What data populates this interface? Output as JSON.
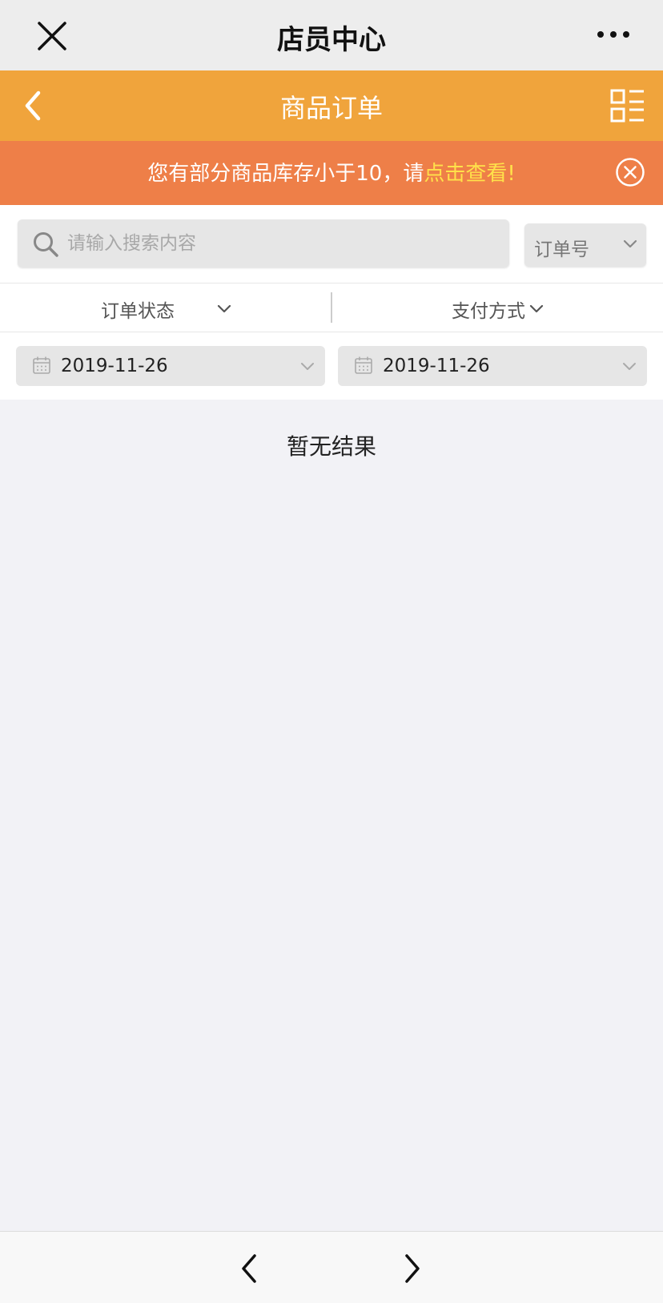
{
  "topbar": {
    "title": "店员中心",
    "close_icon": "close-icon",
    "more_icon": "more-icon"
  },
  "header": {
    "title": "商品订单",
    "back_icon": "chevron-left-icon",
    "menu_icon": "grid-list-icon",
    "color": "#f0a43c"
  },
  "alert": {
    "message": "您有部分商品库存小于10，请",
    "link": "点击查看!",
    "color": "#ee7f48",
    "link_color": "#ffe14a"
  },
  "search": {
    "placeholder": "请输入搜索内容",
    "value": "",
    "type_label": "订单号"
  },
  "filters": {
    "status_label": "订单状态",
    "payment_label": "支付方式"
  },
  "dates": {
    "start": "2019-11-26",
    "end": "2019-11-26"
  },
  "results": {
    "empty_text": "暂无结果"
  },
  "bottom_nav": {
    "prev_icon": "chevron-left-icon",
    "next_icon": "chevron-right-icon"
  }
}
